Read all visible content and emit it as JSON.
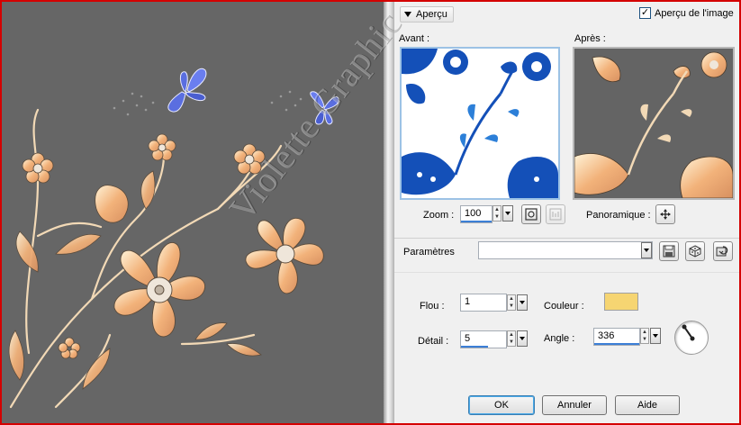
{
  "preview_section": {
    "toggle_label": "Aperçu",
    "image_preview_checkbox_label": "Aperçu de l'image",
    "image_preview_checked": true,
    "before_label": "Avant :",
    "after_label": "Après :"
  },
  "zoom": {
    "label": "Zoom :",
    "value": "100"
  },
  "pan": {
    "label": "Panoramique :"
  },
  "presets": {
    "label": "Paramètres",
    "value": ""
  },
  "blur": {
    "label": "Flou :",
    "value": "1"
  },
  "detail": {
    "label": "Détail :",
    "value": "5"
  },
  "color": {
    "label": "Couleur :",
    "value": "#f6d572"
  },
  "angle": {
    "label": "Angle :",
    "value": "336"
  },
  "buttons": {
    "ok": "OK",
    "cancel": "Annuler",
    "help": "Aide"
  },
  "watermark": "Violette Graphic",
  "colors": {
    "canvas_bg": "#666666",
    "flower_gold": "#f0b878",
    "butterfly_blue": "#5a6ee0",
    "preview_blue": "#1450b8",
    "window_frame": "#d40000"
  }
}
